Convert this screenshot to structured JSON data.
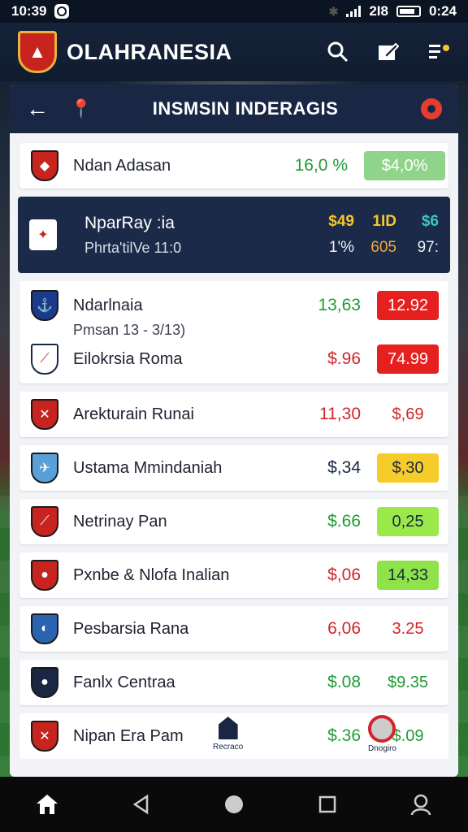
{
  "status": {
    "time": "10:39",
    "right_text": "2I8",
    "clock2": "0:24"
  },
  "app": {
    "title": "OLAHRANESIA"
  },
  "panel": {
    "title": "INSMSIN INDERAGIS"
  },
  "rows": [
    {
      "name": "Ndan Adasan",
      "value": "16,0 %",
      "odds": "$4,0%",
      "value_color": "green",
      "odds_bg": "#8fd48a",
      "odds_color": "#ffffff",
      "crest": "#c7241f"
    }
  ],
  "highlight": {
    "line1": "NparRay :ia",
    "line2": "Phrta'tilVe 11:0",
    "cells": [
      "$49",
      "1ID",
      "$6",
      "1'%",
      "605",
      "97:"
    ]
  },
  "double": {
    "name1": "Ndarlnaia",
    "value1": "13,63",
    "odds1": "12.92",
    "subline": "Pmsan 13 - 3/13)",
    "name2": "Eilokrsia Roma",
    "value2": "$.96",
    "odds2": "74.99"
  },
  "list": [
    {
      "name": "Arekturain Runai",
      "value": "11,30",
      "odds": "$,69",
      "value_color": "red",
      "odds_bg": "#ffffff",
      "odds_color": "#d4232b",
      "crest": "#c7241f"
    },
    {
      "name": "Ustama Mmindaniah",
      "value": "$,34",
      "odds": "$,30",
      "value_color": "navy",
      "odds_bg": "#f6cc2a",
      "odds_color": "#1a2744",
      "crest": "#5aa0d8"
    },
    {
      "name": "Netrinay Pan",
      "value": "$.66",
      "odds": "0,25",
      "value_color": "green",
      "odds_bg": "#9be84a",
      "odds_color": "#1a2744",
      "crest": "#c7241f"
    },
    {
      "name": "Pxnbe & Nlofa Inalian",
      "value": "$,06",
      "odds": "14,33",
      "value_color": "red",
      "odds_bg": "#8ee34a",
      "odds_color": "#1a2744",
      "crest": "#c7241f"
    },
    {
      "name": "Pesbarsia Rana",
      "value": "6,06",
      "odds": "3.25",
      "value_color": "red",
      "odds_bg": "#ffffff",
      "odds_color": "#d4232b",
      "crest": "#2a64b0"
    },
    {
      "name": "Fanlx Centraa",
      "value": "$.08",
      "odds": "$9.35",
      "value_color": "green",
      "odds_bg": "#ffffff",
      "odds_color": "#1f9c33",
      "crest": "#1a2744"
    }
  ],
  "last": {
    "name": "Nipan Era Pam",
    "value": "$.36",
    "odds": "$.09",
    "badge_left": "Recraco",
    "badge_right": "Dnogiro"
  }
}
